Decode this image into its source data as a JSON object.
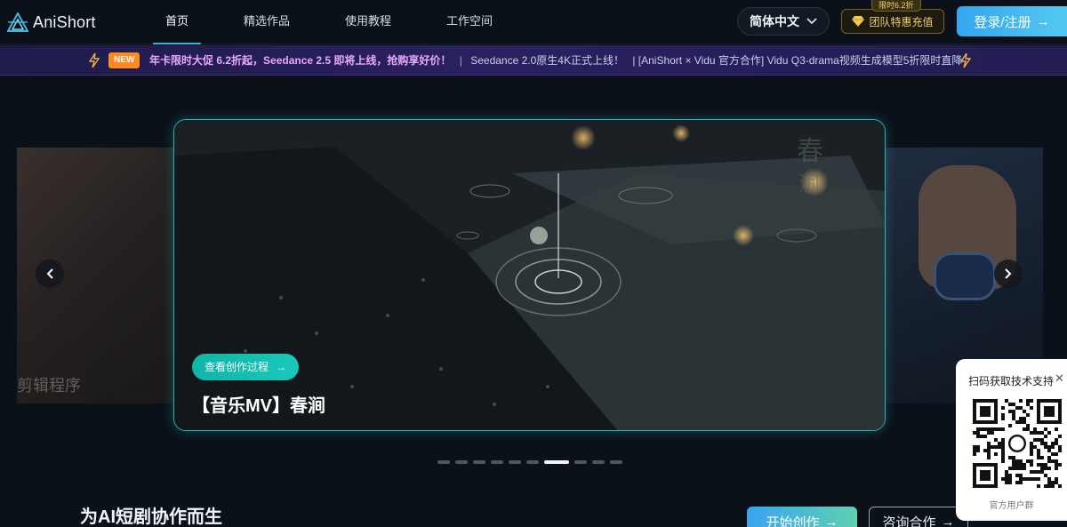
{
  "brand": {
    "name": "AniShort"
  },
  "nav": {
    "links": [
      {
        "label": "首页",
        "active": true
      },
      {
        "label": "精选作品",
        "active": false
      },
      {
        "label": "使用教程",
        "active": false
      },
      {
        "label": "工作空间",
        "active": false
      }
    ],
    "language": "简体中文",
    "team_badge": "限时6.2折",
    "team_button": "团队特惠充值",
    "login_button": "登录/注册"
  },
  "announcement": {
    "badge": "NEW",
    "highlight": "年卡限时大促 6.2折起，Seedance 2.5 即将上线，抢购享好价！",
    "separator": "|",
    "item2": "Seedance 2.0原生4K正式上线！",
    "item3": "| [AniShort × Vidu 官方合作] Vidu Q3-drama视频生成模型5折限时直降"
  },
  "carousel": {
    "left_slide_text": "剪辑程序",
    "watch_button": "查看创作过程",
    "title": "【音乐MV】春涧",
    "dot_count": 10,
    "active_dot": 6
  },
  "section": {
    "title": "为AI短剧协作而生",
    "start_button": "开始创作",
    "consult_button": "咨询合作"
  },
  "qr": {
    "title": "扫码获取技术支持",
    "caption": "官方用户群"
  },
  "colors": {
    "accent": "#2fb3d6",
    "teal_button": "#11b4a8",
    "gold": "#f2cf6e",
    "new_badge": "#ff8a1f",
    "announce_highlight": "#e8a8ff"
  }
}
